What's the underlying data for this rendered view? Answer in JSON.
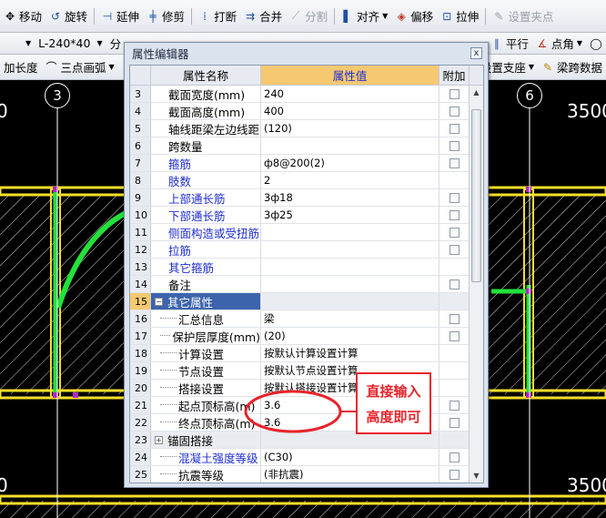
{
  "toolbar_row1": {
    "move": "移动",
    "rotate": "旋转",
    "extend": "延伸",
    "trim": "修剪",
    "break": "打断",
    "merge": "合并",
    "split": "分割",
    "align": "对齐",
    "offset": "偏移",
    "stretch": "拉伸",
    "set_grip": "设置夹点"
  },
  "toolbar_row2": {
    "beam_type": "L-240*40",
    "partial_left": "分",
    "parallel": "平行",
    "point_angle": "点角"
  },
  "toolbar_row3": {
    "length_partial": "加长度",
    "three_point_arc": "三点画弧",
    "set_support": "设置支座",
    "beam_span_data": "梁跨数据"
  },
  "canvas": {
    "axis_left": "3",
    "axis_right": "6",
    "dim_right_top": "3500",
    "dim_right_bottom": "3500",
    "dim_left_top": "0",
    "dim_left_bottom": "0",
    "colors": {
      "beam_yellow": "#f7df2a",
      "green_line": "#22e23a",
      "axis_white": "#ffffff"
    }
  },
  "dialog": {
    "title": "属性编辑器",
    "close_label": "x",
    "columns": {
      "name": "属性名称",
      "value": "属性值",
      "add": "附加"
    },
    "rows": [
      {
        "num": "3",
        "name": "截面宽度(mm)",
        "value": "240",
        "name_color": "black",
        "checkbox": true
      },
      {
        "num": "4",
        "name": "截面高度(mm)",
        "value": "400",
        "name_color": "black",
        "checkbox": true
      },
      {
        "num": "5",
        "name": "轴线距梁左边线距",
        "value": "(120)",
        "name_color": "black",
        "checkbox": true
      },
      {
        "num": "6",
        "name": "跨数量",
        "value": "",
        "name_color": "black",
        "checkbox": true
      },
      {
        "num": "7",
        "name": "箍筋",
        "value": "ф8@200(2)",
        "name_color": "blue",
        "checkbox": true
      },
      {
        "num": "8",
        "name": "肢数",
        "value": "2",
        "name_color": "blue",
        "checkbox": false
      },
      {
        "num": "9",
        "name": "上部通长筋",
        "value": "3ф18",
        "name_color": "blue",
        "checkbox": true
      },
      {
        "num": "10",
        "name": "下部通长筋",
        "value": "3ф25",
        "name_color": "blue",
        "checkbox": true
      },
      {
        "num": "11",
        "name": "侧面构造或受扭筋",
        "value": "",
        "name_color": "blue",
        "checkbox": true
      },
      {
        "num": "12",
        "name": "拉筋",
        "value": "",
        "name_color": "blue",
        "checkbox": true
      },
      {
        "num": "13",
        "name": "其它箍筋",
        "value": "",
        "name_color": "blue",
        "checkbox": false
      },
      {
        "num": "14",
        "name": "备注",
        "value": "",
        "name_color": "black",
        "checkbox": true
      },
      {
        "num": "15",
        "name": "其它属性",
        "value": "",
        "name_color": "white",
        "checkbox": false,
        "group": true,
        "selected": true
      },
      {
        "num": "16",
        "name": "汇总信息",
        "value": "梁",
        "name_color": "black",
        "checkbox": true,
        "child": true
      },
      {
        "num": "17",
        "name": "保护层厚度(mm)",
        "value": "(20)",
        "name_color": "black",
        "checkbox": true,
        "child": true
      },
      {
        "num": "18",
        "name": "计算设置",
        "value": "按默认计算设置计算",
        "name_color": "black",
        "checkbox": false,
        "child": true
      },
      {
        "num": "19",
        "name": "节点设置",
        "value": "按默认节点设置计算",
        "name_color": "black",
        "checkbox": false,
        "child": true
      },
      {
        "num": "20",
        "name": "搭接设置",
        "value": "按默认搭接设置计算",
        "name_color": "black",
        "checkbox": false,
        "child": true
      },
      {
        "num": "21",
        "name": "起点顶标高(m)",
        "value": "3.6",
        "name_color": "black",
        "checkbox": true,
        "child": true
      },
      {
        "num": "22",
        "name": "终点顶标高(m)",
        "value": "3.6",
        "name_color": "black",
        "checkbox": true,
        "child": true
      },
      {
        "num": "23",
        "name": "锚固搭接",
        "value": "",
        "name_color": "black",
        "checkbox": false,
        "group": true,
        "collapsed": true
      },
      {
        "num": "24",
        "name": "混凝土强度等级",
        "value": "(C30)",
        "name_color": "blue",
        "checkbox": true,
        "child": true
      },
      {
        "num": "25",
        "name": "抗震等级",
        "value": "(非抗震)",
        "name_color": "black",
        "checkbox": true,
        "child": true
      }
    ],
    "pm_minus": "−",
    "pm_plus": "+"
  },
  "annotation": {
    "line1": "直接输入",
    "line2": "高度即可",
    "color": "#e8232b"
  }
}
